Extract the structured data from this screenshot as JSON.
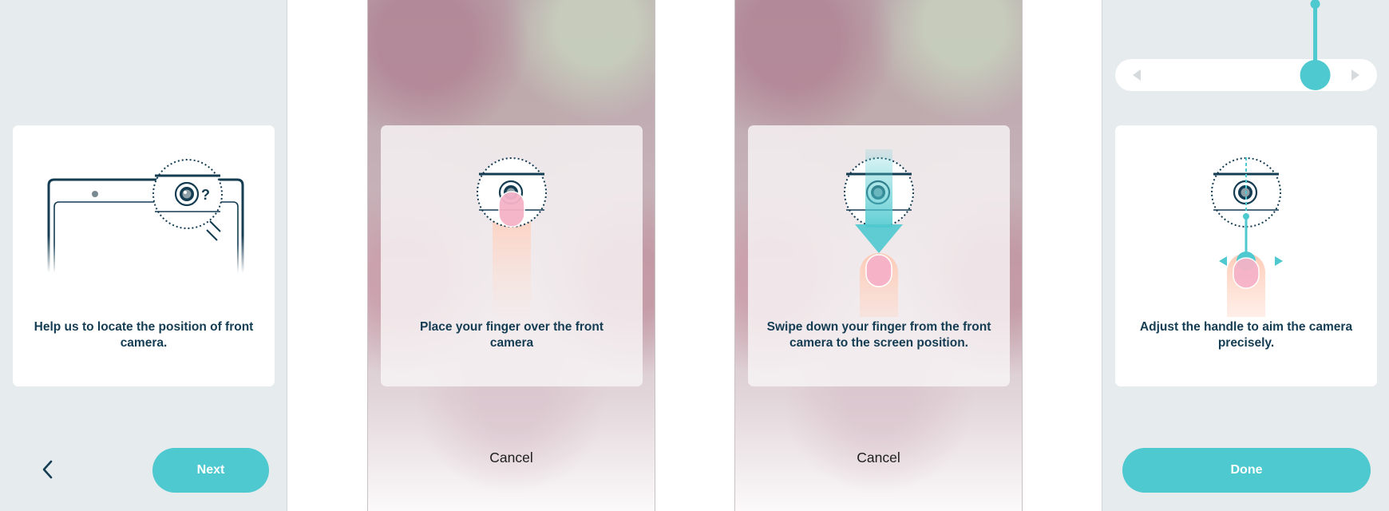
{
  "screens": [
    {
      "id": "locate",
      "message": "Help us to locate the position of front camera.",
      "next_label": "Next",
      "back_icon": "chevron-left-icon",
      "help_glyph": "?"
    },
    {
      "id": "place",
      "message": "Place your finger over the front camera",
      "cancel_label": "Cancel"
    },
    {
      "id": "swipe",
      "message": "Swipe down your finger from the front camera to the screen position.",
      "cancel_label": "Cancel"
    },
    {
      "id": "adjust",
      "message": "Adjust the handle to aim the camera precisely.",
      "done_label": "Done",
      "slider_left_icon": "triangle-left-icon",
      "slider_right_icon": "triangle-right-icon",
      "slider_position": 0.79
    }
  ],
  "colors": {
    "accent": "#4ec9cf",
    "text_dark": "#143c52",
    "panel_bg": "#e6ebee",
    "finger_pink": "#f6b3c8",
    "finger_glow": "#ffd9c8"
  }
}
